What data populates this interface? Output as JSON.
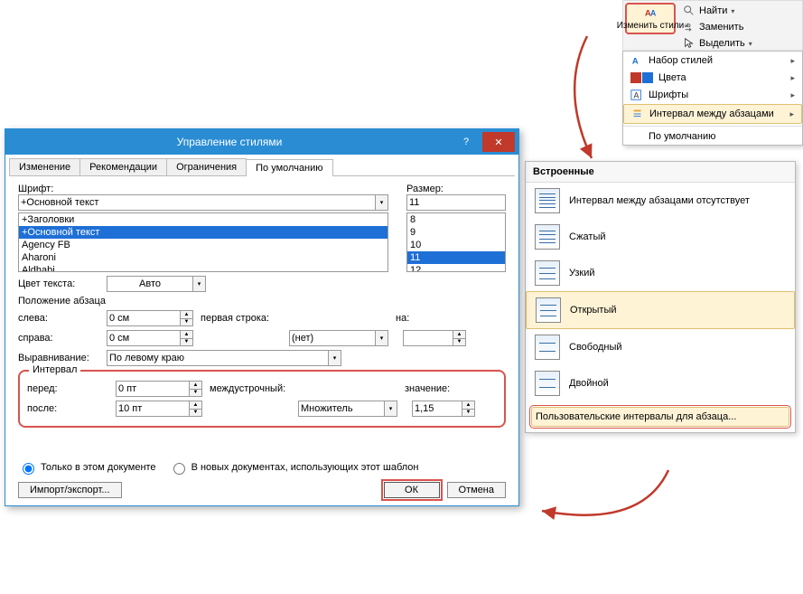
{
  "ribbon": {
    "change_styles": "Изменить\nстили",
    "find": "Найти",
    "replace": "Заменить",
    "select": "Выделить"
  },
  "styles_menu": {
    "items": [
      {
        "label": "Набор стилей"
      },
      {
        "label": "Цвета"
      },
      {
        "label": "Шрифты"
      },
      {
        "label": "Интервал между абзацами",
        "selected": true
      },
      {
        "label": "По умолчанию"
      }
    ]
  },
  "builtin": {
    "header": "Встроенные",
    "presets": [
      {
        "label": "Интервал между абзацами отсутствует"
      },
      {
        "label": "Сжатый"
      },
      {
        "label": "Узкий"
      },
      {
        "label": "Открытый",
        "selected": true
      },
      {
        "label": "Свободный"
      },
      {
        "label": "Двойной"
      }
    ],
    "custom": "Пользовательские интервалы для абзаца..."
  },
  "dialog": {
    "title": "Управление стилями",
    "tabs": [
      "Изменение",
      "Рекомендации",
      "Ограничения",
      "По умолчанию"
    ],
    "active_tab": 3,
    "font_label": "Шрифт:",
    "font_value": "+Основной текст",
    "font_list": [
      "+Заголовки",
      "+Основной текст",
      "Agency FB",
      "Aharoni",
      "Aldhabi"
    ],
    "font_list_selected": 1,
    "size_label": "Размер:",
    "size_value": "11",
    "size_list": [
      "8",
      "9",
      "10",
      "11",
      "12"
    ],
    "size_list_selected": 3,
    "text_color_label": "Цвет текста:",
    "text_color_value": "Авто",
    "para_position": "Положение абзаца",
    "left_label": "слева:",
    "left_value": "0 см",
    "right_label": "справа:",
    "right_value": "0 см",
    "align_label": "Выравнивание:",
    "align_value": "По левому краю",
    "first_line_label": "первая строка:",
    "first_line_value": "(нет)",
    "on_label": "на:",
    "on_value": "",
    "interval_label": "Интервал",
    "before_label": "перед:",
    "before_value": "0 пт",
    "after_label": "после:",
    "after_value": "10 пт",
    "line_spacing_label": "междустрочный:",
    "line_spacing_value": "Множитель",
    "value_label": "значение:",
    "value_value": "1,15",
    "radio_this_doc": "Только в этом документе",
    "radio_new_docs": "В новых документах, использующих этот шаблон",
    "import_export": "Импорт/экспорт...",
    "ok": "ОК",
    "cancel": "Отмена"
  }
}
